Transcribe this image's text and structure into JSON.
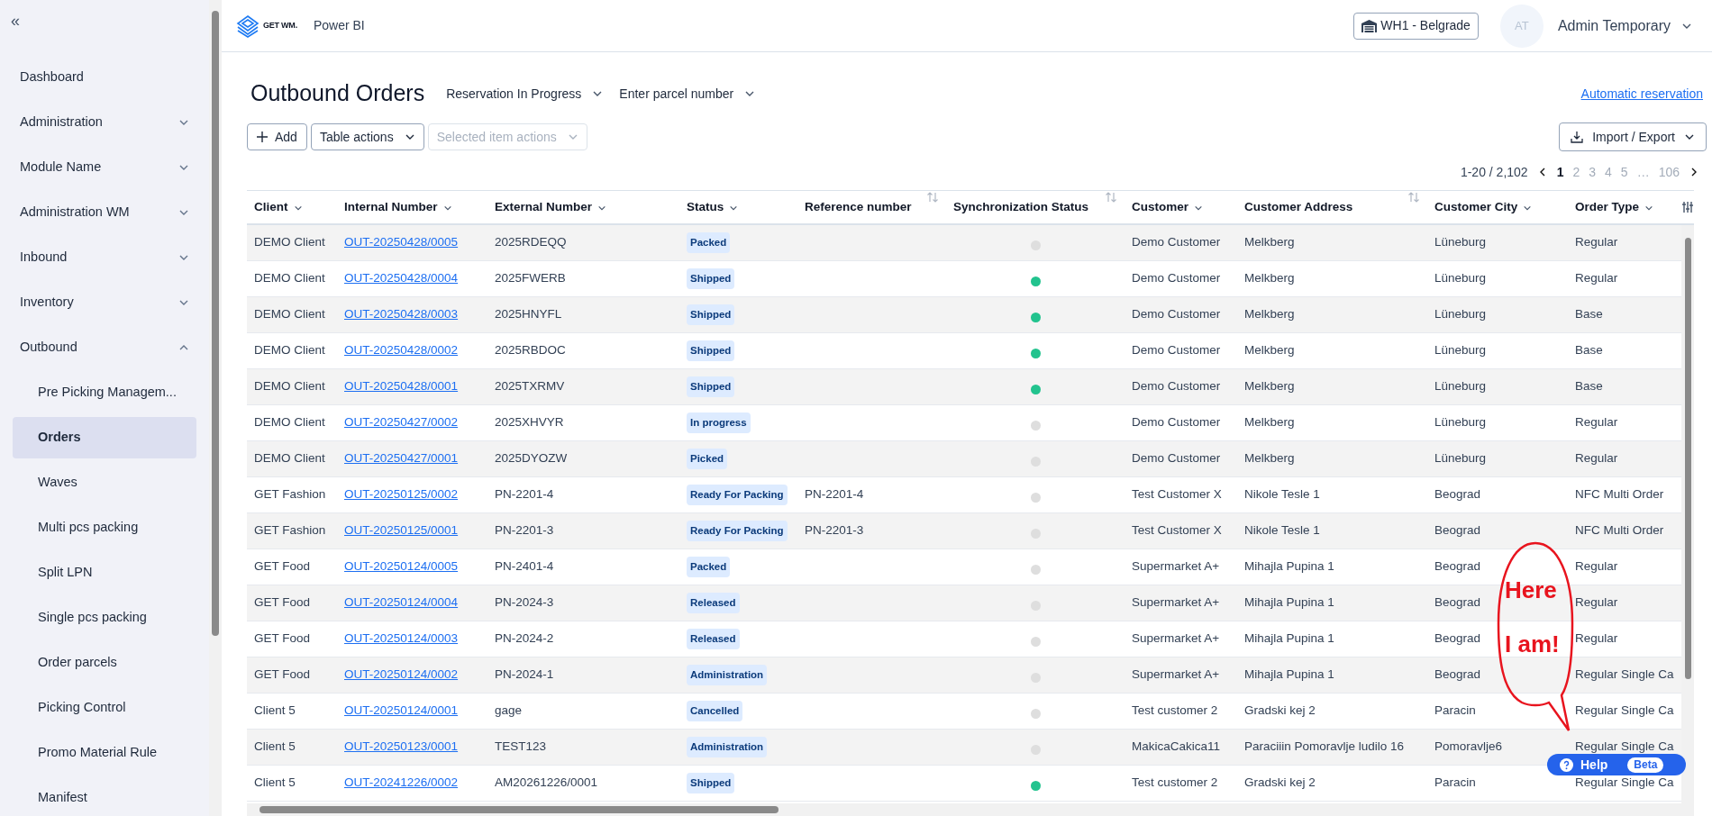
{
  "sidebar": {
    "collapse_glyph": "«",
    "items": [
      {
        "label": "Dashboard",
        "kind": "link",
        "selected": false
      },
      {
        "label": "Administration",
        "kind": "group",
        "expanded": false,
        "selected": false
      },
      {
        "label": "Module Name",
        "kind": "group",
        "expanded": false,
        "selected": false
      },
      {
        "label": "Administration WM",
        "kind": "group",
        "expanded": false,
        "selected": false
      },
      {
        "label": "Inbound",
        "kind": "group",
        "expanded": false,
        "selected": false
      },
      {
        "label": "Inventory",
        "kind": "group",
        "expanded": false,
        "selected": false
      },
      {
        "label": "Outbound",
        "kind": "group",
        "expanded": true,
        "selected": false,
        "children": [
          {
            "label": "Pre Picking Managem...",
            "selected": false
          },
          {
            "label": "Orders",
            "selected": true
          },
          {
            "label": "Waves",
            "selected": false
          },
          {
            "label": "Multi pcs packing",
            "selected": false
          },
          {
            "label": "Split LPN",
            "selected": false
          },
          {
            "label": "Single pcs packing",
            "selected": false
          },
          {
            "label": "Order parcels",
            "selected": false
          },
          {
            "label": "Picking Control",
            "selected": false
          },
          {
            "label": "Promo Material Rule",
            "selected": false
          },
          {
            "label": "Manifest",
            "selected": false
          }
        ]
      }
    ]
  },
  "header": {
    "logo": "GET WM.",
    "app_link": "Power BI",
    "warehouse": "WH1 - Belgrade",
    "avatar": "AT",
    "user": "Admin Temporary"
  },
  "page": {
    "title": "Outbound Orders",
    "filters": [
      "Reservation In Progress",
      "Enter parcel number"
    ],
    "auto_link": "Automatic reservation"
  },
  "toolbar": {
    "add": "Add",
    "table_actions": "Table actions",
    "selected_actions": {
      "label": "Selected item actions",
      "disabled": true
    },
    "import_export": "Import / Export"
  },
  "pagination": {
    "range": "1-20 / 2,102",
    "pages": [
      {
        "label": "1",
        "selected": true
      },
      {
        "label": "2",
        "selected": false
      },
      {
        "label": "3",
        "selected": false
      },
      {
        "label": "4",
        "selected": false
      },
      {
        "label": "5",
        "selected": false
      },
      {
        "label": "…",
        "selected": false
      },
      {
        "label": "106",
        "selected": false
      }
    ]
  },
  "table": {
    "columns": [
      {
        "label": "Client",
        "kind": "filter"
      },
      {
        "label": "Internal Number",
        "kind": "filter"
      },
      {
        "label": "External Number",
        "kind": "filter"
      },
      {
        "label": "Status",
        "kind": "filter"
      },
      {
        "label": "Reference number",
        "kind": "sortable"
      },
      {
        "label": "Synchronization Status",
        "kind": "sortable"
      },
      {
        "label": "Customer",
        "kind": "filter"
      },
      {
        "label": "Customer Address",
        "kind": "sortable"
      },
      {
        "label": "Customer City",
        "kind": "filter"
      },
      {
        "label": "Order Type",
        "kind": "filter"
      }
    ],
    "rows": [
      {
        "client": "DEMO Client",
        "internal": "OUT-20250428/0005",
        "external": "2025RDEQQ",
        "status": "Packed",
        "sync": {
          "color": "#dedede"
        },
        "customer": "Demo Customer",
        "address": "Melkberg",
        "city": "Lüneburg",
        "order_type": "Regular"
      },
      {
        "client": "DEMO Client",
        "internal": "OUT-20250428/0004",
        "external": "2025FWERB",
        "status": "Shipped",
        "sync": {
          "color": "#22c38e"
        },
        "customer": "Demo Customer",
        "address": "Melkberg",
        "city": "Lüneburg",
        "order_type": "Regular"
      },
      {
        "client": "DEMO Client",
        "internal": "OUT-20250428/0003",
        "external": "2025HNYFL",
        "status": "Shipped",
        "sync": {
          "color": "#22c38e"
        },
        "customer": "Demo Customer",
        "address": "Melkberg",
        "city": "Lüneburg",
        "order_type": "Base"
      },
      {
        "client": "DEMO Client",
        "internal": "OUT-20250428/0002",
        "external": "2025RBDOC",
        "status": "Shipped",
        "sync": {
          "color": "#22c38e"
        },
        "customer": "Demo Customer",
        "address": "Melkberg",
        "city": "Lüneburg",
        "order_type": "Base"
      },
      {
        "client": "DEMO Client",
        "internal": "OUT-20250428/0001",
        "external": "2025TXRMV",
        "status": "Shipped",
        "sync": {
          "color": "#22c38e"
        },
        "customer": "Demo Customer",
        "address": "Melkberg",
        "city": "Lüneburg",
        "order_type": "Base"
      },
      {
        "client": "DEMO Client",
        "internal": "OUT-20250427/0002",
        "external": "2025XHVYR",
        "status": "In progress",
        "sync": {
          "color": "#dedede"
        },
        "customer": "Demo Customer",
        "address": "Melkberg",
        "city": "Lüneburg",
        "order_type": "Regular"
      },
      {
        "client": "DEMO Client",
        "internal": "OUT-20250427/0001",
        "external": "2025DYOZW",
        "status": "Picked",
        "sync": {
          "color": "#dedede"
        },
        "customer": "Demo Customer",
        "address": "Melkberg",
        "city": "Lüneburg",
        "order_type": "Regular"
      },
      {
        "client": "GET Fashion",
        "internal": "OUT-20250125/0002",
        "external": "PN-2201-4",
        "status": "Ready For Packing",
        "reference": "PN-2201-4",
        "sync": {
          "color": "#dedede"
        },
        "customer": "Test Customer X",
        "address": "Nikole Tesle 1",
        "city": "Beograd",
        "order_type": "NFC Multi Order"
      },
      {
        "client": "GET Fashion",
        "internal": "OUT-20250125/0001",
        "external": "PN-2201-3",
        "status": "Ready For Packing",
        "reference": "PN-2201-3",
        "sync": {
          "color": "#dedede"
        },
        "customer": "Test Customer X",
        "address": "Nikole Tesle 1",
        "city": "Beograd",
        "order_type": "NFC Multi Order"
      },
      {
        "client": "GET Food",
        "internal": "OUT-20250124/0005",
        "external": "PN-2401-4",
        "status": "Packed",
        "sync": {
          "color": "#dedede"
        },
        "customer": "Supermarket A+",
        "address": "Mihajla Pupina 1",
        "city": "Beograd",
        "order_type": "Regular"
      },
      {
        "client": "GET Food",
        "internal": "OUT-20250124/0004",
        "external": "PN-2024-3",
        "status": "Released",
        "sync": {
          "color": "#dedede"
        },
        "customer": "Supermarket A+",
        "address": "Mihajla Pupina 1",
        "city": "Beograd",
        "order_type": "Regular"
      },
      {
        "client": "GET Food",
        "internal": "OUT-20250124/0003",
        "external": "PN-2024-2",
        "status": "Released",
        "sync": {
          "color": "#dedede"
        },
        "customer": "Supermarket A+",
        "address": "Mihajla Pupina 1",
        "city": "Beograd",
        "order_type": "Regular"
      },
      {
        "client": "GET Food",
        "internal": "OUT-20250124/0002",
        "external": "PN-2024-1",
        "status": "Administration",
        "sync": {
          "color": "#dedede"
        },
        "customer": "Supermarket A+",
        "address": "Mihajla Pupina 1",
        "city": "Beograd",
        "order_type": "Regular Single Ca"
      },
      {
        "client": "Client 5",
        "internal": "OUT-20250124/0001",
        "external": "gage",
        "status": "Cancelled",
        "sync": {
          "color": "#dedede"
        },
        "customer": "Test customer 2",
        "address": "Gradski kej 2",
        "city": "Paracin",
        "order_type": "Regular Single Ca"
      },
      {
        "client": "Client 5",
        "internal": "OUT-20250123/0001",
        "external": "TEST123",
        "status": "Administration",
        "sync": {
          "color": "#dedede"
        },
        "customer": "MakicaCakica11",
        "address": "Paraciiin Pomoravlje ludilo 16",
        "city": "Pomoravlje6",
        "order_type": "Regular Single Ca"
      },
      {
        "client": "Client 5",
        "internal": "OUT-20241226/0002",
        "external": "AM20261226/0001",
        "status": "Shipped",
        "sync": {
          "color": "#22c38e"
        },
        "customer": "Test customer 2",
        "address": "Gradski kej 2",
        "city": "Paracin",
        "order_type": "Regular Single Ca"
      }
    ]
  },
  "help": {
    "label": "Help",
    "badge": "Beta"
  },
  "annotation": {
    "lines": [
      "Here",
      "I am!"
    ]
  }
}
